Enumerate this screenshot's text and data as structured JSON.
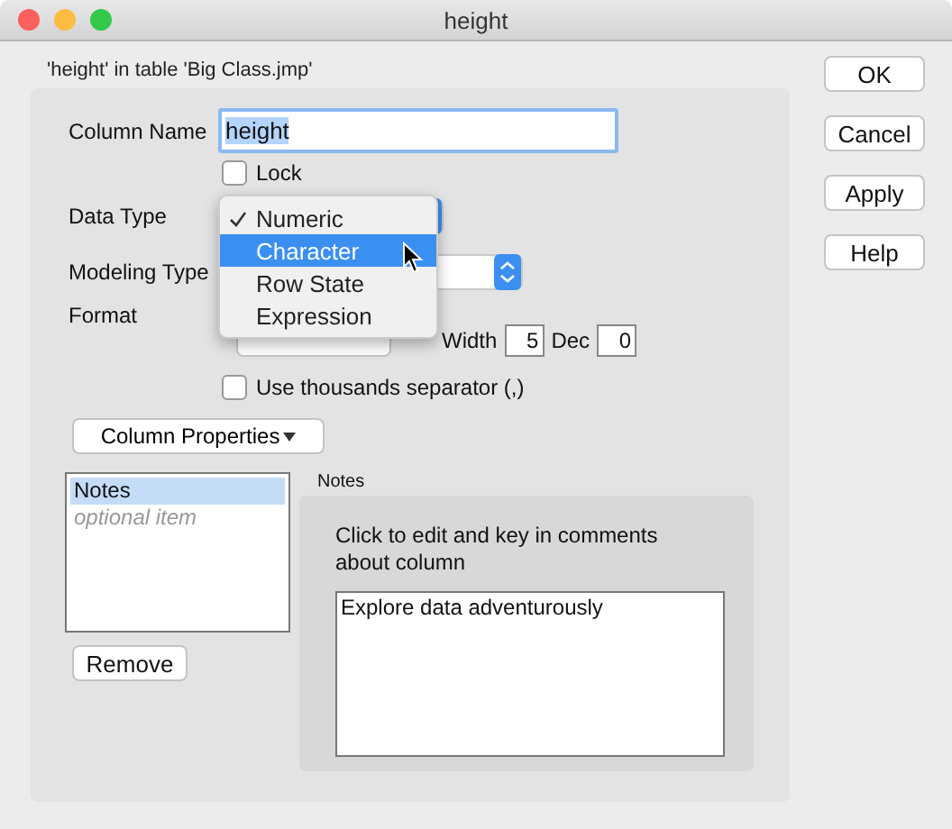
{
  "window": {
    "title": "height"
  },
  "subtitle": "'height' in table 'Big Class.jmp'",
  "form": {
    "column_name": {
      "label": "Column Name",
      "value": "height"
    },
    "lock": {
      "label": "Lock",
      "checked": false
    },
    "data_type": {
      "label": "Data Type"
    },
    "modeling_type": {
      "label": "Modeling Type"
    },
    "format": {
      "label": "Format",
      "width_label": "Width",
      "width_value": "5",
      "dec_label": "Dec",
      "dec_value": "0"
    },
    "thousands": {
      "label": "Use thousands separator (,)",
      "checked": false
    },
    "column_properties": "Column Properties"
  },
  "properties_list": {
    "items": [
      {
        "label": "Notes",
        "kind": "item",
        "selected": true
      },
      {
        "label": "optional item",
        "kind": "placeholder",
        "selected": false
      }
    ]
  },
  "remove_button": "Remove",
  "notes": {
    "title": "Notes",
    "instructions": "Click to edit and key in comments about column",
    "value": "Explore data adventurously"
  },
  "buttons": [
    "OK",
    "Cancel",
    "Apply",
    "Help"
  ],
  "data_type_menu": {
    "items": [
      {
        "label": "Numeric",
        "checked": true,
        "selected": false
      },
      {
        "label": "Character",
        "checked": false,
        "selected": true
      },
      {
        "label": "Row State",
        "checked": false,
        "selected": false
      },
      {
        "label": "Expression",
        "checked": false,
        "selected": false
      }
    ]
  }
}
